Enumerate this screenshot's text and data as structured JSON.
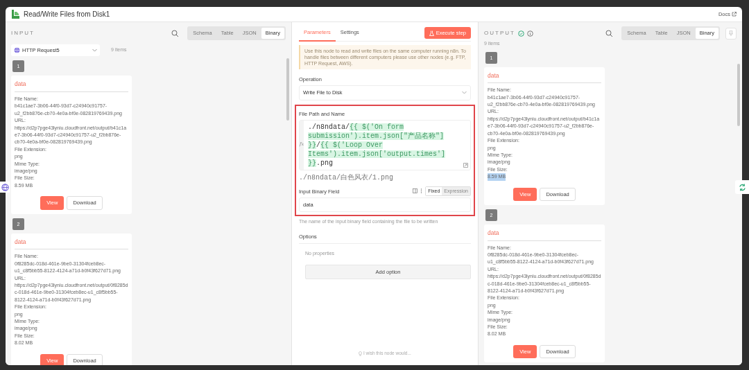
{
  "window": {
    "title": "Read/Write Files from Disk1",
    "docs_link": "Docs"
  },
  "input_panel": {
    "heading": "INPUT",
    "view_tabs": [
      {
        "label": "Schema",
        "selected": false
      },
      {
        "label": "Table",
        "selected": false
      },
      {
        "label": "JSON",
        "selected": false
      },
      {
        "label": "Binary",
        "selected": true
      }
    ],
    "source": "HTTP Request5",
    "item_count": "9 items",
    "items": [
      {
        "index": "1",
        "title": "data",
        "fields": [
          {
            "label": "File Name:",
            "value": "b41c1ae7-3b06-44f0-93d7-c24940c91757-u2_f2bb876e-cb70-4e0a-bf0e-082819769439.png",
            "selected": false
          },
          {
            "label": "URL:",
            "value": "https://d2p7pge43lyniu.cloudfront.net/output/b41c1ae7-3b06-44f0-93d7-c24940c91757-u2_f2bb876e-cb70-4e0a-bf0e-082819769439.png",
            "selected": false
          },
          {
            "label": "File Extension:",
            "value": "png",
            "selected": false
          },
          {
            "label": "Mime Type:",
            "value": "image/png",
            "selected": false
          },
          {
            "label": "File Size:",
            "value": "8.59 MB",
            "selected": false
          }
        ],
        "buttons": [
          "View",
          "Download"
        ]
      },
      {
        "index": "2",
        "title": "data",
        "fields": [
          {
            "label": "File Name:",
            "value": "0f8285dc-018d-461e-9be0-31304fceb8ec-u1_c8f5bb55-8122-4124-a71d-b0f43f627d71.png",
            "selected": false
          },
          {
            "label": "URL:",
            "value": "https://d2p7pge43lyniu.cloudfront.net/output/0f8285dc-018d-461e-9be0-31304fceb8ec-u1_c8f5bb55-8122-4124-a71d-b0f43f627d71.png",
            "selected": false
          },
          {
            "label": "File Extension:",
            "value": "png",
            "selected": false
          },
          {
            "label": "Mime Type:",
            "value": "image/png",
            "selected": false
          },
          {
            "label": "File Size:",
            "value": "8.02 MB",
            "selected": false
          }
        ],
        "buttons": [
          "View",
          "Download"
        ]
      }
    ]
  },
  "parameters_panel": {
    "tabs": [
      {
        "label": "Parameters",
        "selected": true
      },
      {
        "label": "Settings",
        "selected": false
      }
    ],
    "execute_button": "Execute step",
    "notice": "Use this node to read and write files on the same computer running n8n. To handle files between different computers please use other nodes (e.g. FTP, HTTP Request, AWS).",
    "operation": {
      "label": "Operation",
      "value": "Write File to Disk"
    },
    "file_path": {
      "label": "File Path and Name",
      "highlighted": true,
      "fx_label": "fx",
      "segments": [
        {
          "kind": "text",
          "text": "./n8ndata/"
        },
        {
          "kind": "expression",
          "text": "{{ $('On form submission').item.json[\"产品名称\"] }}"
        },
        {
          "kind": "text",
          "text": "/"
        },
        {
          "kind": "expression",
          "text": "{{ $('Loop Over Items').item.json['output.times'] }}"
        },
        {
          "kind": "text",
          "text": ".png"
        }
      ],
      "preview": "./n8ndata/白色风衣/1.png"
    },
    "binary_field": {
      "label": "Input Binary Field",
      "mode_tabs": [
        {
          "label": "Fixed",
          "selected": true
        },
        {
          "label": "Expression",
          "selected": false
        }
      ],
      "value": "data",
      "hint": "The name of the input binary field containing the file to be written"
    },
    "options": {
      "label": "Options",
      "empty_text": "No properties",
      "add_button": "Add option"
    },
    "feedback": "I wish this node would..."
  },
  "output_panel": {
    "heading": "OUTPUT",
    "view_tabs": [
      {
        "label": "Schema",
        "selected": false
      },
      {
        "label": "Table",
        "selected": false
      },
      {
        "label": "JSON",
        "selected": false
      },
      {
        "label": "Binary",
        "selected": true
      }
    ],
    "item_count": "9 items",
    "items": [
      {
        "index": "1",
        "title": "data",
        "fields": [
          {
            "label": "File Name:",
            "value": "b41c1ae7-3b06-44f0-93d7-c24940c91757-u2_f2bb876e-cb70-4e0a-bf0e-082819769439.png",
            "selected": false
          },
          {
            "label": "URL:",
            "value": "https://d2p7pge43lyniu.cloudfront.net/output/b41c1ae7-3b06-44f0-93d7-c24940c91757-u2_f2bb876e-cb70-4e0a-bf0e-082819769439.png",
            "selected": false
          },
          {
            "label": "File Extension:",
            "value": "png",
            "selected": false
          },
          {
            "label": "Mime Type:",
            "value": "image/png",
            "selected": false
          },
          {
            "label": "File Size:",
            "value": "8.59 MB",
            "selected": true
          }
        ],
        "buttons": [
          "View",
          "Download"
        ]
      },
      {
        "index": "2",
        "title": "data",
        "fields": [
          {
            "label": "File Name:",
            "value": "0f8285dc-018d-461e-9be0-31304fceb8ec-u1_c8f5bb55-8122-4124-a71d-b0f43f627d71.png",
            "selected": false
          },
          {
            "label": "URL:",
            "value": "https://d2p7pge43lyniu.cloudfront.net/output/0f8285dc-018d-461e-9be0-31304fceb8ec-u1_c8f5bb55-8122-4124-a71d-b0f43f627d71.png",
            "selected": false
          },
          {
            "label": "File Extension:",
            "value": "png",
            "selected": false
          },
          {
            "label": "Mime Type:",
            "value": "image/png",
            "selected": false
          },
          {
            "label": "File Size:",
            "value": "8.02 MB",
            "selected": false
          }
        ],
        "buttons": [
          "View",
          "Download"
        ]
      }
    ]
  }
}
